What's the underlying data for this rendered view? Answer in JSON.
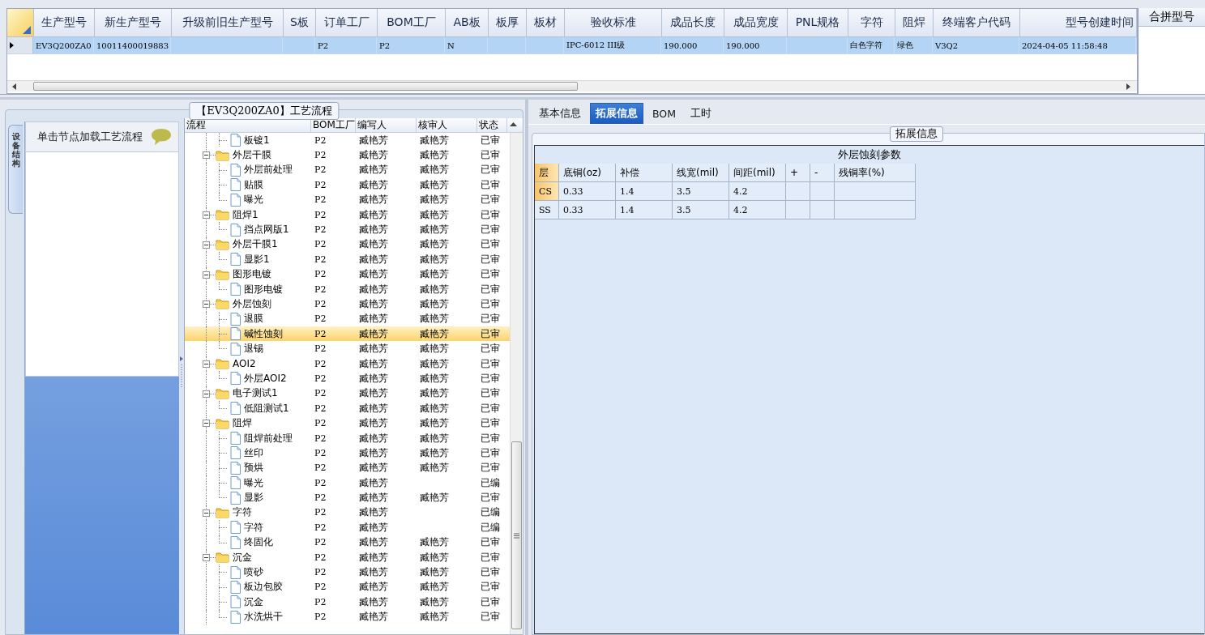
{
  "main_grid": {
    "columns": [
      "生产型号",
      "新生产型号",
      "升级前旧生产型号",
      "S板",
      "订单工厂",
      "BOM工厂",
      "AB板",
      "板厚",
      "板材",
      "验收标准",
      "成品长度",
      "成品宽度",
      "PNL规格",
      "字符",
      "阻焊",
      "终端客户代码",
      "型号创建时间"
    ],
    "rows": [
      {
        "selected": true,
        "cells": [
          "EV3Q200ZA0",
          "10011400019883",
          "",
          "",
          "P2",
          "P2",
          "N",
          "",
          "",
          "IPC-6012 III级",
          "190.000",
          "190.000",
          "",
          "白色字符",
          "绿色",
          "V3Q2",
          "2024-04-05 11:58:48"
        ]
      }
    ]
  },
  "merge_panel": {
    "title": "合拼型号"
  },
  "process_panel": {
    "title": "【EV3Q200ZA0】工艺流程",
    "side_tab": "设备结构",
    "hint": "单击节点加载工艺流程",
    "tree": {
      "columns": [
        "流程",
        "BOM工厂",
        "编写人",
        "核审人",
        "状态"
      ],
      "nodes": [
        {
          "kind": "file",
          "name": "板镀1",
          "bom": "P2",
          "writer": "臧艳芳",
          "reviewer": "臧艳芳",
          "status": "已审",
          "selected": false
        },
        {
          "kind": "folder",
          "expanded": true,
          "name": "外层干膜",
          "bom": "P2",
          "writer": "臧艳芳",
          "reviewer": "臧艳芳",
          "status": "已审",
          "selected": false,
          "children": [
            {
              "kind": "file",
              "name": "外层前处理",
              "bom": "P2",
              "writer": "臧艳芳",
              "reviewer": "臧艳芳",
              "status": "已审",
              "selected": false
            },
            {
              "kind": "file",
              "name": "贴膜",
              "bom": "P2",
              "writer": "臧艳芳",
              "reviewer": "臧艳芳",
              "status": "已审",
              "selected": false
            },
            {
              "kind": "file",
              "name": "曝光",
              "bom": "P2",
              "writer": "臧艳芳",
              "reviewer": "臧艳芳",
              "status": "已审",
              "selected": false
            }
          ]
        },
        {
          "kind": "folder",
          "expanded": true,
          "name": "阻焊1",
          "bom": "P2",
          "writer": "臧艳芳",
          "reviewer": "臧艳芳",
          "status": "已审",
          "selected": false,
          "children": [
            {
              "kind": "file",
              "name": "挡点网版1",
              "bom": "P2",
              "writer": "臧艳芳",
              "reviewer": "臧艳芳",
              "status": "已审",
              "selected": false
            }
          ]
        },
        {
          "kind": "folder",
          "expanded": true,
          "name": "外层干膜1",
          "bom": "P2",
          "writer": "臧艳芳",
          "reviewer": "臧艳芳",
          "status": "已审",
          "selected": false,
          "children": [
            {
              "kind": "file",
              "name": "显影1",
              "bom": "P2",
              "writer": "臧艳芳",
              "reviewer": "臧艳芳",
              "status": "已审",
              "selected": false
            }
          ]
        },
        {
          "kind": "folder",
          "expanded": true,
          "name": "图形电镀",
          "bom": "P2",
          "writer": "臧艳芳",
          "reviewer": "臧艳芳",
          "status": "已审",
          "selected": false,
          "children": [
            {
              "kind": "file",
              "name": "图形电镀",
              "bom": "P2",
              "writer": "臧艳芳",
              "reviewer": "臧艳芳",
              "status": "已审",
              "selected": false
            }
          ]
        },
        {
          "kind": "folder",
          "expanded": true,
          "name": "外层蚀刻",
          "bom": "P2",
          "writer": "臧艳芳",
          "reviewer": "臧艳芳",
          "status": "已审",
          "selected": false,
          "children": [
            {
              "kind": "file",
              "name": "退膜",
              "bom": "P2",
              "writer": "臧艳芳",
              "reviewer": "臧艳芳",
              "status": "已审",
              "selected": false
            },
            {
              "kind": "file",
              "name": "碱性蚀刻",
              "bom": "P2",
              "writer": "臧艳芳",
              "reviewer": "臧艳芳",
              "status": "已审",
              "selected": true
            },
            {
              "kind": "file",
              "name": "退锡",
              "bom": "P2",
              "writer": "臧艳芳",
              "reviewer": "臧艳芳",
              "status": "已审",
              "selected": false
            }
          ]
        },
        {
          "kind": "folder",
          "expanded": true,
          "name": "AOI2",
          "bom": "P2",
          "writer": "臧艳芳",
          "reviewer": "臧艳芳",
          "status": "已审",
          "selected": false,
          "children": [
            {
              "kind": "file",
              "name": "外层AOI2",
              "bom": "P2",
              "writer": "臧艳芳",
              "reviewer": "臧艳芳",
              "status": "已审",
              "selected": false
            }
          ]
        },
        {
          "kind": "folder",
          "expanded": true,
          "name": "电子测试1",
          "bom": "P2",
          "writer": "臧艳芳",
          "reviewer": "臧艳芳",
          "status": "已审",
          "selected": false,
          "children": [
            {
              "kind": "file",
              "name": "低阻测试1",
              "bom": "P2",
              "writer": "臧艳芳",
              "reviewer": "臧艳芳",
              "status": "已审",
              "selected": false
            }
          ]
        },
        {
          "kind": "folder",
          "expanded": true,
          "name": "阻焊",
          "bom": "P2",
          "writer": "臧艳芳",
          "reviewer": "臧艳芳",
          "status": "已审",
          "selected": false,
          "children": [
            {
              "kind": "file",
              "name": "阻焊前处理",
              "bom": "P2",
              "writer": "臧艳芳",
              "reviewer": "臧艳芳",
              "status": "已审",
              "selected": false
            },
            {
              "kind": "file",
              "name": "丝印",
              "bom": "P2",
              "writer": "臧艳芳",
              "reviewer": "臧艳芳",
              "status": "已审",
              "selected": false
            },
            {
              "kind": "file",
              "name": "预烘",
              "bom": "P2",
              "writer": "臧艳芳",
              "reviewer": "臧艳芳",
              "status": "已审",
              "selected": false
            },
            {
              "kind": "file",
              "name": "曝光",
              "bom": "P2",
              "writer": "臧艳芳",
              "status": "已编",
              "selected": false
            },
            {
              "kind": "file",
              "name": "显影",
              "bom": "P2",
              "writer": "臧艳芳",
              "reviewer": "臧艳芳",
              "status": "已审",
              "selected": false
            }
          ]
        },
        {
          "kind": "folder",
          "expanded": true,
          "name": "字符",
          "bom": "P2",
          "writer": "臧艳芳",
          "status": "已编",
          "selected": false,
          "children": [
            {
              "kind": "file",
              "name": "字符",
              "bom": "P2",
              "writer": "臧艳芳",
              "status": "已编",
              "selected": false
            },
            {
              "kind": "file",
              "name": "终固化",
              "bom": "P2",
              "writer": "臧艳芳",
              "reviewer": "臧艳芳",
              "status": "已审",
              "selected": false
            }
          ]
        },
        {
          "kind": "folder",
          "expanded": true,
          "name": "沉金",
          "bom": "P2",
          "writer": "臧艳芳",
          "reviewer": "臧艳芳",
          "status": "已审",
          "selected": false,
          "children": [
            {
              "kind": "file",
              "name": "喷砂",
              "bom": "P2",
              "writer": "臧艳芳",
              "reviewer": "臧艳芳",
              "status": "已审",
              "selected": false
            },
            {
              "kind": "file",
              "name": "板边包胶",
              "bom": "P2",
              "writer": "臧艳芳",
              "reviewer": "臧艳芳",
              "status": "已审",
              "selected": false
            },
            {
              "kind": "file",
              "name": "沉金",
              "bom": "P2",
              "writer": "臧艳芳",
              "reviewer": "臧艳芳",
              "status": "已审",
              "selected": false
            },
            {
              "kind": "file",
              "name": "水洗烘干",
              "bom": "P2",
              "writer": "臧艳芳",
              "reviewer": "臧艳芳",
              "status": "已审",
              "selected": false
            }
          ]
        }
      ]
    }
  },
  "detail_panel": {
    "tabs": [
      {
        "label": "基本信息",
        "selected": false
      },
      {
        "label": "拓展信息",
        "selected": true
      },
      {
        "label": "BOM",
        "selected": false
      },
      {
        "label": "工时",
        "selected": false
      }
    ],
    "group_title": "拓展信息",
    "table": {
      "title": "外层蚀刻参数",
      "columns": [
        "层",
        "底铜(oz)",
        "补偿",
        "线宽(mil)",
        "间距(mil)",
        "+",
        "-",
        "残铜率(%)"
      ],
      "rows": [
        {
          "selected": true,
          "cells": [
            "CS",
            "0.33",
            "1.4",
            "3.5",
            "4.2",
            "",
            "",
            ""
          ]
        },
        {
          "selected": false,
          "cells": [
            "SS",
            "0.33",
            "1.4",
            "3.5",
            "4.2",
            "",
            "",
            ""
          ]
        }
      ]
    }
  }
}
